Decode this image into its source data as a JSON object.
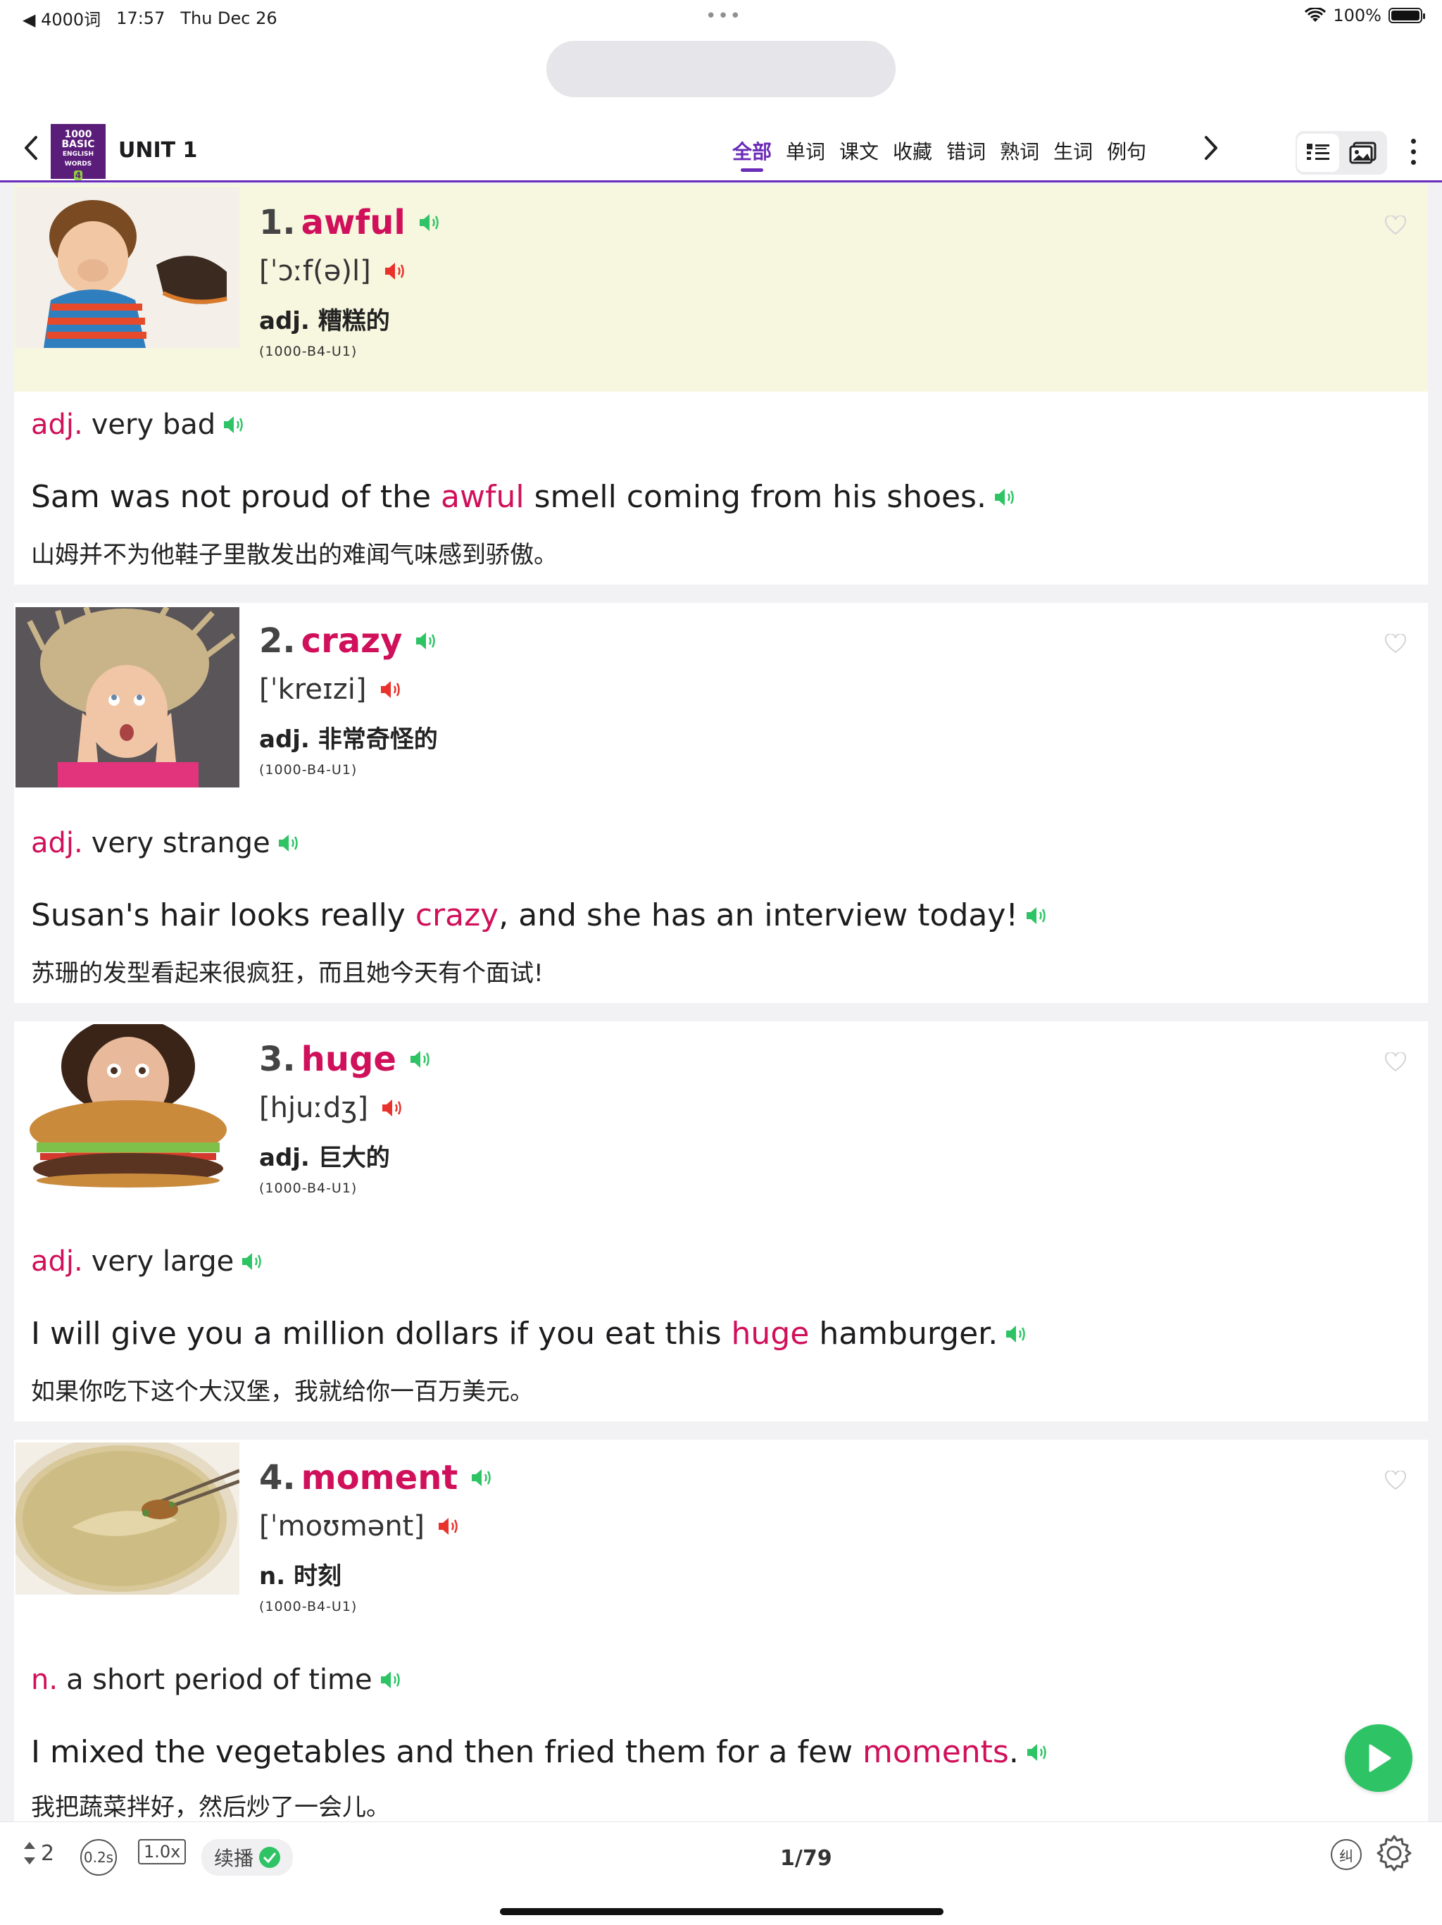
{
  "status_bar": {
    "back_app": "◀ 4000词",
    "time": "17:57",
    "date": "Thu Dec 26",
    "dots": "•••",
    "battery": "100%"
  },
  "header": {
    "unit_title": "UNIT 1",
    "book_cover": {
      "line1": "1000",
      "line2": "BASIC",
      "line3": "ENGLISH",
      "line4": "WORDS",
      "num": "4"
    },
    "tabs": [
      {
        "label": "全部",
        "active": true
      },
      {
        "label": "单词"
      },
      {
        "label": "课文"
      },
      {
        "label": "收藏"
      },
      {
        "label": "错词"
      },
      {
        "label": "熟词"
      },
      {
        "label": "生词"
      },
      {
        "label": "例句"
      }
    ]
  },
  "words": [
    {
      "num": "1.",
      "word": "awful",
      "phonetic": "[ˈɔːf(ə)l]",
      "meaning": "adj. 糟糕的",
      "source": "(1000-B4-U1)",
      "pos": "adj.",
      "definition": "very bad",
      "sentence_pre": "Sam was not proud of the ",
      "sentence_kw": "awful",
      "sentence_post": " smell coming from his shoes.",
      "translation": "山姆并不为他鞋子里散发出的难闻气味感到骄傲。",
      "image": "boy-holding-nose-shoe"
    },
    {
      "num": "2.",
      "word": "crazy",
      "phonetic": "[ˈkreɪzi]",
      "meaning": "adj. 非常奇怪的",
      "source": "(1000-B4-U1)",
      "pos": "adj.",
      "definition": "very strange",
      "sentence_pre": "Susan's hair looks really ",
      "sentence_kw": "crazy",
      "sentence_post": ", and she has an interview today!",
      "translation": "苏珊的发型看起来很疯狂，而且她今天有个面试!",
      "image": "girl-messy-hair"
    },
    {
      "num": "3.",
      "word": "huge",
      "phonetic": "[hjuːdʒ]",
      "meaning": "adj. 巨大的",
      "source": "(1000-B4-U1)",
      "pos": "adj.",
      "definition": "very large",
      "sentence_pre": "I will give you a million dollars if you eat this ",
      "sentence_kw": "huge",
      "sentence_post": " hamburger.",
      "translation": "如果你吃下这个大汉堡，我就给你一百万美元。",
      "image": "woman-huge-hamburger"
    },
    {
      "num": "4.",
      "word": "moment",
      "phonetic": "[ˈmoʊmənt]",
      "meaning": "n. 时刻",
      "source": "(1000-B4-U1)",
      "pos": "n.",
      "definition": "a short period of time",
      "sentence_pre": "I mixed the vegetables and then fried them for a few ",
      "sentence_kw": "moments",
      "sentence_post": ".",
      "translation": "我把蔬菜拌好，然后炒了一会儿。",
      "image": "soup-with-chopsticks"
    }
  ],
  "bottom_bar": {
    "repeat": "2",
    "interval": "0.2s",
    "speed": "1.0x",
    "continue_label": "续播",
    "page": "1/79",
    "correct_label": "纠"
  },
  "colors": {
    "accent_purple": "#6a2bb8",
    "keyword_red": "#d0105a",
    "speaker_green": "#2ec466",
    "speaker_red": "#e8322b",
    "highlight_bg": "#f7f6df"
  }
}
